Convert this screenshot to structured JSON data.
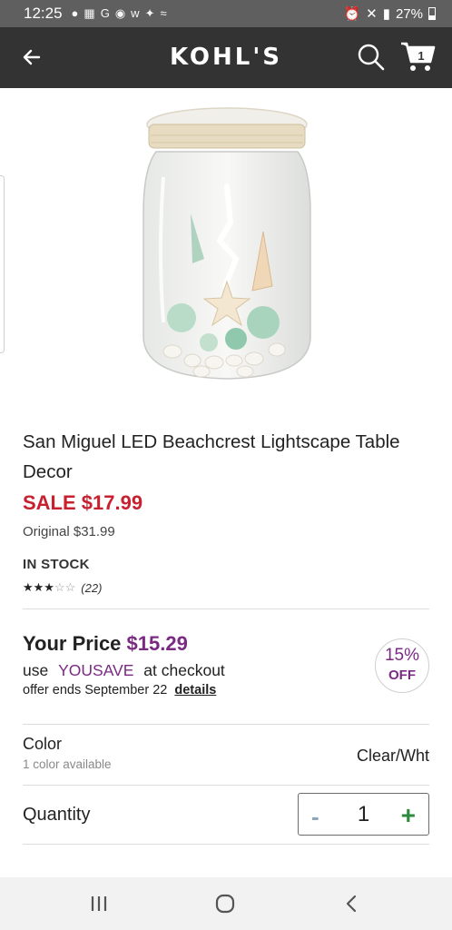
{
  "status_bar": {
    "time": "12:25",
    "battery": "27%"
  },
  "header": {
    "brand": "KOHL'S",
    "cart_count": "1"
  },
  "product": {
    "title": "San Miguel LED Beachcrest Lightscape Table Decor",
    "sale_price": "SALE $17.99",
    "original_price": "Original $31.99",
    "stock_status": "IN STOCK",
    "rating_stars": 3,
    "rating_max": 5,
    "review_count": "(22)"
  },
  "offer": {
    "your_price_label": "Your Price",
    "your_price_value": "$15.29",
    "use_prefix": "use",
    "coupon_code": "YOUSAVE",
    "use_suffix": "at checkout",
    "offer_ends": "offer ends September 22",
    "details_link": "details",
    "badge_percent": "15%",
    "badge_off": "OFF"
  },
  "color": {
    "label": "Color",
    "sub_label": "1 color available",
    "value": "Clear/Wht"
  },
  "quantity": {
    "label": "Quantity",
    "minus": "-",
    "value": "1",
    "plus": "+"
  },
  "icons": {
    "back": "arrow-left-icon",
    "search": "search-icon",
    "cart": "cart-icon",
    "nav_recents": "recents-icon",
    "nav_home": "home-icon",
    "nav_back": "chevron-left-icon"
  },
  "colors": {
    "header_bg": "#333333",
    "status_bg": "#5f5f5f",
    "sale_red": "#c8202e",
    "purple": "#7b2a84",
    "plus_green": "#2e8a3c"
  }
}
